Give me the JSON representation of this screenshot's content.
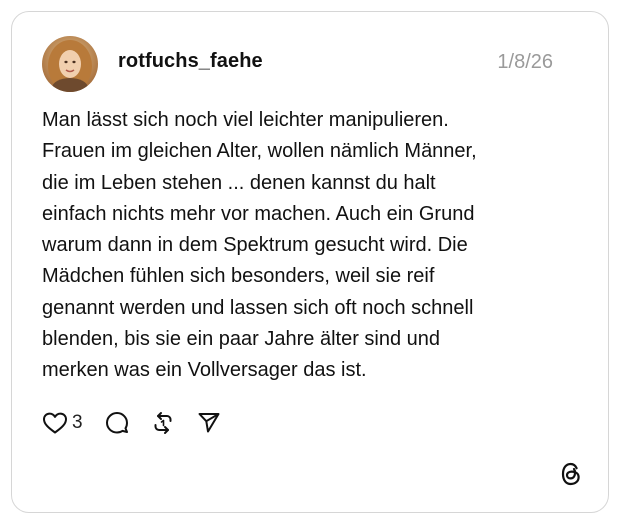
{
  "post": {
    "username": "rotfuchs_faehe",
    "timestamp": "1/8/26",
    "lines": [
      "Man lässt sich noch viel leichter manipulieren.",
      "Frauen im gleichen Alter, wollen nämlich Männer,",
      "die im Leben stehen ... denen kannst du halt",
      "einfach nichts mehr vor machen. Auch ein Grund",
      "warum dann in dem Spektrum gesucht wird. Die",
      "Mädchen fühlen sich besonders, weil sie reif",
      "genannt werden und lassen sich oft noch schnell",
      "blenden, bis sie ein paar Jahre älter sind und",
      "merken was ein Vollversager das ist."
    ],
    "like_count": "3"
  },
  "icons": {
    "like": "heart-icon",
    "reply": "speech-bubble-icon",
    "repost": "repost-arrows-icon",
    "share": "send-icon",
    "brand": "threads-logo-icon"
  },
  "colors": {
    "text": "#111111",
    "timestamp": "#9a9a9a",
    "border": "#d6d6d6",
    "background": "#ffffff"
  }
}
